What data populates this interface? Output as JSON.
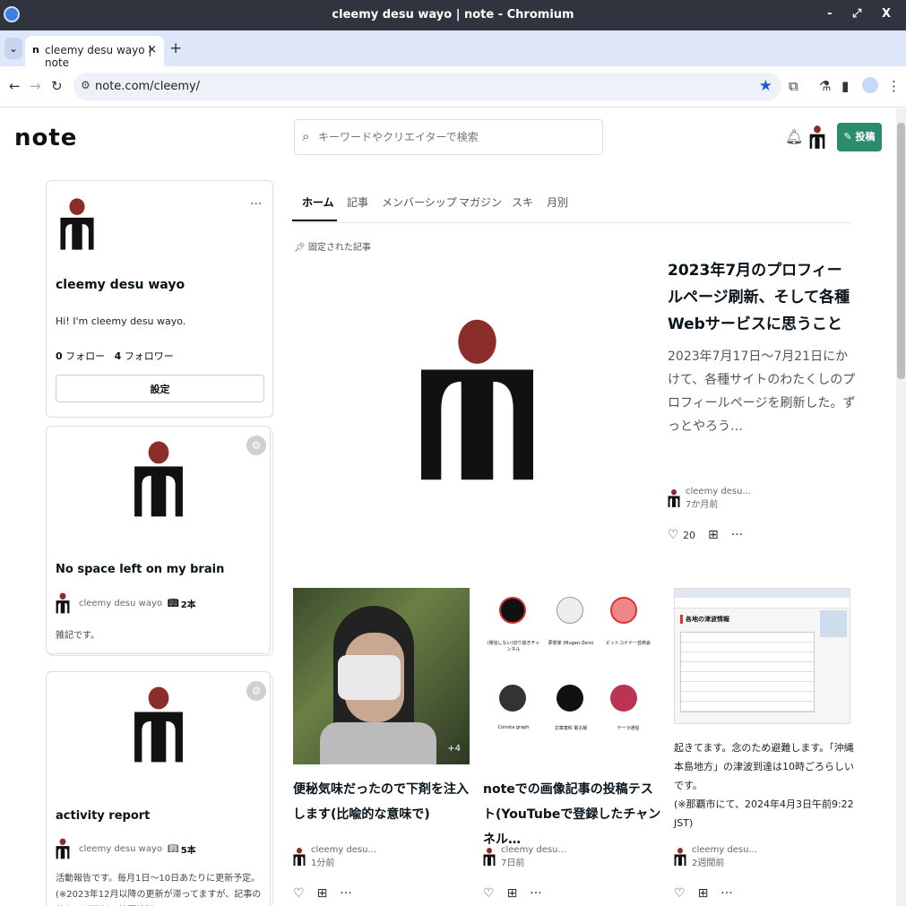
{
  "window": {
    "title": "cleemy desu wayo | note - Chromium",
    "controls": "- ⤢ X"
  },
  "tabs": [
    {
      "favicon": "n",
      "label": "cleemy desu wayo | note",
      "close": "×"
    }
  ],
  "new_tab": "+",
  "address": {
    "url": "note.com/cleemy/"
  },
  "header": {
    "logo": "note",
    "search_placeholder": "キーワードやクリエイターで検索",
    "post_label": "投稿",
    "post_color": "#2b8c6d"
  },
  "profile": {
    "name": "cleemy desu wayo",
    "bio": "Hi! I'm cleemy desu wayo.",
    "follow_count": "0",
    "follow_label": "フォロー",
    "follower_count": "4",
    "follower_label": "フォロワー",
    "settings_label": "設定",
    "menu": "···"
  },
  "magazines": [
    {
      "title": "No space left on my brain",
      "author": "cleemy desu wayo",
      "count": "2本",
      "desc": "雑記です。"
    },
    {
      "title": "activity report",
      "author": "cleemy desu wayo",
      "count": "5本",
      "desc": "活動報告です。毎月1日〜10日あたりに更新予定。(※2023年12月以降の更新が滞ってますが、記事の仕上げが面倒で放置状態"
    }
  ],
  "nav_tabs": [
    "ホーム",
    "記事",
    "メンバーシップ",
    "マガジン",
    "スキ",
    "月別"
  ],
  "pinned_label": "固定された記事",
  "featured": {
    "title": "2023年7月のプロフィールページ刷新、そして各種Webサービスに思うこと",
    "desc": "2023年7月17日〜7月21日にかけて、各種サイトのわたくしのプロフィールページを刷新した。ずっとやろう…",
    "author": "cleemy desu...",
    "time": "7か月前",
    "likes": "20"
  },
  "articles": [
    {
      "title": "便秘気味だったので下剤を注入します(比喩的な意味で)",
      "author": "cleemy desu...",
      "time": "1分前",
      "badge": "+4"
    },
    {
      "title": "noteでの画像記事の投稿テスト(YouTubeで登録したチャンネル…",
      "author": "cleemy desu...",
      "time": "7日前",
      "channels": [
        "(発信しない)切り抜きチャンネル",
        "夢想家 (Mugen-Zero)",
        "ビットコイナー芸術会",
        "Coinsta graph",
        "文章専科 電子版",
        "テーラ通信"
      ]
    },
    {
      "title": "起きてます。念のため避難します。「沖縄本島地方」の津波到達は10時ごろらしいです。\n(※那覇市にて、2024年4月3日午前9:22 JST)",
      "author": "cleemy desu...",
      "time": "2週間前",
      "mini_heading": "各地の津波情報"
    }
  ],
  "colors": {
    "avatar_head": "#8b2d2a",
    "avatar_body": "#111111"
  }
}
